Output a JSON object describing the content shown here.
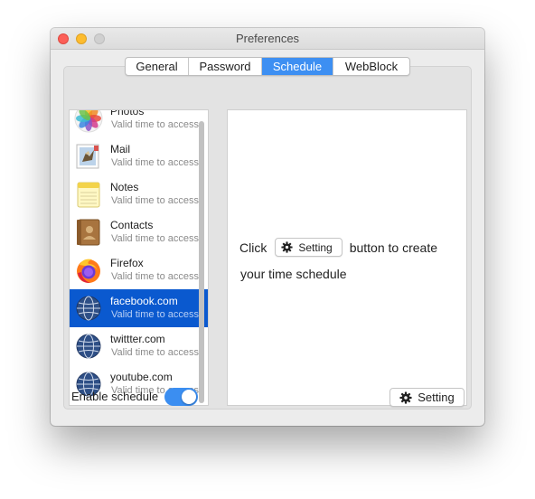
{
  "window": {
    "title": "Preferences"
  },
  "tabs": [
    {
      "label": "General",
      "active": false
    },
    {
      "label": "Password",
      "active": false
    },
    {
      "label": "Schedule",
      "active": true
    },
    {
      "label": "WebBlock",
      "active": false
    }
  ],
  "app_list": [
    {
      "name": "Photos",
      "sub": "Valid time to access",
      "icon": "photos-icon",
      "selected": false
    },
    {
      "name": "Mail",
      "sub": "Valid time to access",
      "icon": "mail-icon",
      "selected": false
    },
    {
      "name": "Notes",
      "sub": "Valid time to access",
      "icon": "notes-icon",
      "selected": false
    },
    {
      "name": "Contacts",
      "sub": "Valid time to access",
      "icon": "contacts-icon",
      "selected": false
    },
    {
      "name": "Firefox",
      "sub": "Valid time to access",
      "icon": "firefox-icon",
      "selected": false
    },
    {
      "name": "facebook.com",
      "sub": "Valid time to access",
      "icon": "globe-icon",
      "selected": true
    },
    {
      "name": "twittter.com",
      "sub": "Valid time to access",
      "icon": "globe-icon",
      "selected": false
    },
    {
      "name": "youtube.com",
      "sub": "Valid time to access",
      "icon": "globe-icon",
      "selected": false
    }
  ],
  "detail": {
    "prefix": "Click",
    "button_label": "Setting",
    "suffix": "button to create",
    "line2": "your time schedule"
  },
  "footer": {
    "enable_label": "Enable schedule",
    "enable_on": true,
    "setting_label": "Setting"
  },
  "colors": {
    "accent": "#3d8ff2",
    "selection": "#0a59cf"
  }
}
